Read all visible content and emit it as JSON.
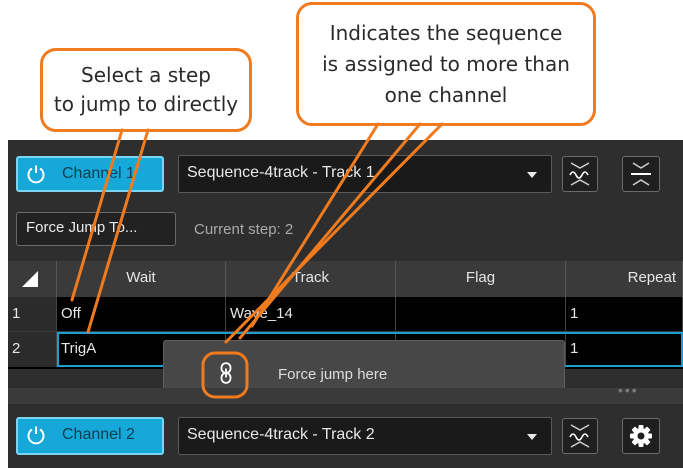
{
  "callouts": {
    "left": [
      "Select a step",
      "to jump to directly"
    ],
    "right": [
      "Indicates the sequence",
      "is assigned to more than",
      "one channel"
    ]
  },
  "channel1": {
    "toggle_label": "Channel 1",
    "sequence_value": "Sequence-4track - Track 1",
    "force_jump_label": "Force Jump To...",
    "current_step_label": "Current step: 2"
  },
  "grid": {
    "columns": [
      "Wait",
      "Track",
      "Flag",
      "Repeat"
    ],
    "rows": [
      {
        "num": "1",
        "wait": "Off",
        "track": "Wave_14",
        "flag": "",
        "repeat": "1"
      },
      {
        "num": "2",
        "wait": "TrigA",
        "track": "",
        "flag": "",
        "repeat": "1"
      }
    ]
  },
  "popup": {
    "label": "Force jump here",
    "icon": "link-icon"
  },
  "channel2": {
    "toggle_label": "Channel 2",
    "sequence_value": "Sequence-4track - Track 2"
  },
  "colors": {
    "accent": "#16a8d8",
    "callout_border": "#f07b1f",
    "panel_bg": "#2e2e2e"
  }
}
